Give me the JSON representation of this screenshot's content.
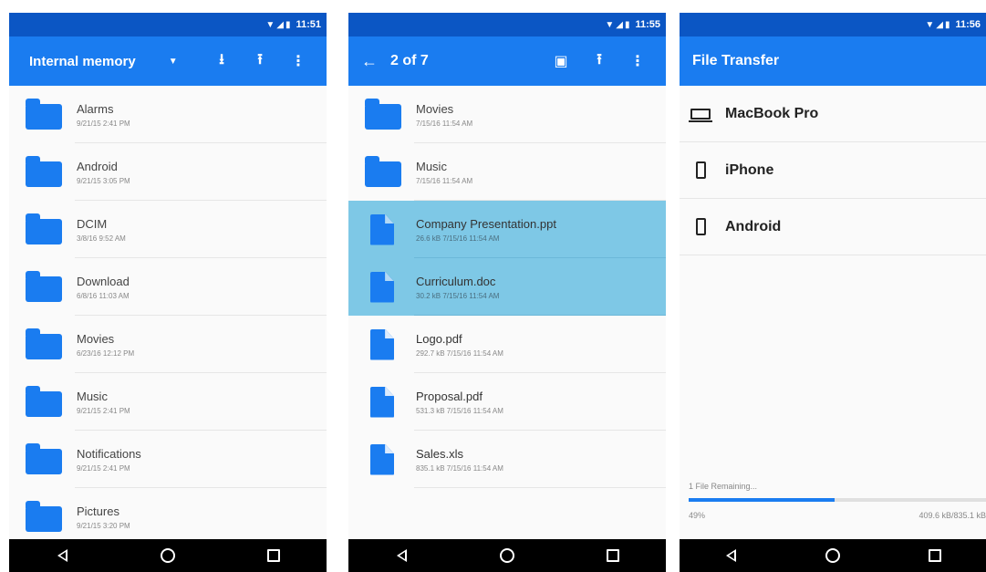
{
  "colors": {
    "status_bar": "#0b56c4",
    "app_bar": "#1a7cf0",
    "selected_row": "#7ec8e6",
    "nav_bar": "#000000"
  },
  "screen1": {
    "time": "11:51",
    "title": "Internal memory",
    "icons": [
      "dropdown-caret-icon",
      "download-icon",
      "upload-icon",
      "more-vert-icon"
    ],
    "items": [
      {
        "name": "Alarms",
        "meta": "9/21/15 2:41 PM"
      },
      {
        "name": "Android",
        "meta": "9/21/15 3:05 PM"
      },
      {
        "name": "DCIM",
        "meta": "3/8/16 9:52 AM"
      },
      {
        "name": "Download",
        "meta": "6/8/16 11:03 AM"
      },
      {
        "name": "Movies",
        "meta": "6/23/16 12:12 PM"
      },
      {
        "name": "Music",
        "meta": "9/21/15 2:41 PM"
      },
      {
        "name": "Notifications",
        "meta": "9/21/15 2:41 PM"
      },
      {
        "name": "Pictures",
        "meta": "9/21/15 3:20 PM"
      }
    ]
  },
  "screen2": {
    "time": "11:55",
    "title": "2 of 7",
    "icons": [
      "back-arrow-icon",
      "select-all-icon",
      "upload-icon",
      "more-vert-icon"
    ],
    "items": [
      {
        "name": "Movies",
        "meta": "7/15/16 11:54 AM",
        "kind": "folder",
        "selected": false
      },
      {
        "name": "Music",
        "meta": "7/15/16 11:54 AM",
        "kind": "folder",
        "selected": false
      },
      {
        "name": "Company Presentation.ppt",
        "meta": "26.6 kB 7/15/16 11:54 AM",
        "kind": "file",
        "selected": true
      },
      {
        "name": "Curriculum.doc",
        "meta": "30.2 kB 7/15/16 11:54 AM",
        "kind": "file",
        "selected": true
      },
      {
        "name": "Logo.pdf",
        "meta": "292.7 kB 7/15/16 11:54 AM",
        "kind": "file",
        "selected": false
      },
      {
        "name": "Proposal.pdf",
        "meta": "531.3 kB 7/15/16 11:54 AM",
        "kind": "file",
        "selected": false
      },
      {
        "name": "Sales.xls",
        "meta": "835.1 kB 7/15/16 11:54 AM",
        "kind": "file",
        "selected": false
      }
    ]
  },
  "screen3": {
    "time": "11:56",
    "title": "File Transfer",
    "devices": [
      {
        "name": "MacBook Pro",
        "icon": "laptop-icon"
      },
      {
        "name": "iPhone",
        "icon": "phone-icon"
      },
      {
        "name": "Android",
        "icon": "phone-icon"
      }
    ],
    "remaining": "1 File Remaining...",
    "percent_text": "49%",
    "progress": 0.49,
    "size_text": "409.6 kB/835.1 kB"
  }
}
